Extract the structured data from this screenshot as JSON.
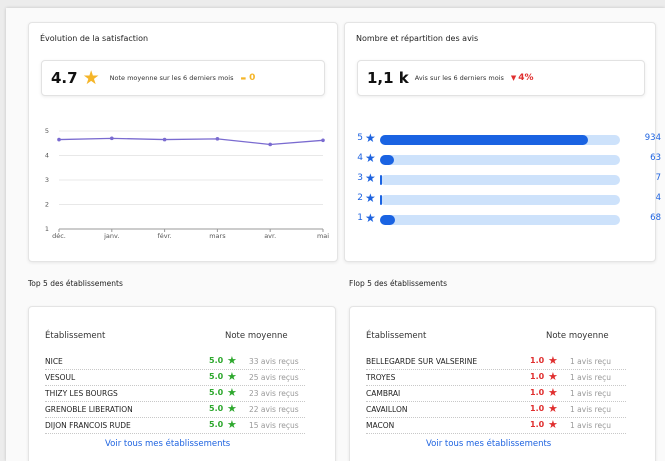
{
  "colors": {
    "accent": "#1e63e0",
    "bar_fill": "#1a63e2",
    "bar_track": "#cde2fb",
    "star_yellow": "#f5b528",
    "green": "#2ea82e",
    "red": "#e02f2f",
    "line": "#7a6bd0"
  },
  "satisfaction": {
    "title": "Évolution de la satisfaction",
    "value": "4.7",
    "star_icon": "star-icon",
    "desc": "Note moyenne sur les 6 derniers mois",
    "trend_symbol": "▬",
    "trend_value": "0"
  },
  "chart_data": {
    "type": "line",
    "x": [
      "déc.",
      "janv.",
      "févr.",
      "mars",
      "avr.",
      "mai"
    ],
    "series": [
      {
        "values": [
          4.65,
          4.7,
          4.65,
          4.68,
          4.45,
          4.62
        ]
      }
    ],
    "yticks": [
      "1",
      "2",
      "3",
      "4",
      "5"
    ],
    "ylim": [
      1,
      5
    ],
    "grid": true,
    "title": "",
    "xlabel": "",
    "ylabel": ""
  },
  "avis": {
    "title": "Nombre et répartition des avis",
    "value": "1,1 k",
    "desc": "Avis sur les 6 derniers mois",
    "trend_symbol": "▼",
    "trend_value": "4%",
    "distribution": [
      {
        "stars": "5",
        "count": "934",
        "fraction": 0.865
      },
      {
        "stars": "4",
        "count": "63",
        "fraction": 0.058
      },
      {
        "stars": "3",
        "count": "7",
        "fraction": 0.006
      },
      {
        "stars": "2",
        "count": "4",
        "fraction": 0.004
      },
      {
        "stars": "1",
        "count": "68",
        "fraction": 0.063
      }
    ]
  },
  "top5": {
    "section_title": "Top 5 des établissements",
    "col_name": "Établissement",
    "col_note": "Note moyenne",
    "rows": [
      {
        "name": "NICE",
        "note": "5.0",
        "avis": "33 avis reçus"
      },
      {
        "name": "VESOUL",
        "note": "5.0",
        "avis": "25 avis reçus"
      },
      {
        "name": "THIZY LES BOURGS",
        "note": "5.0",
        "avis": "23 avis reçus"
      },
      {
        "name": "GRENOBLE LIBERATION",
        "note": "5.0",
        "avis": "22 avis reçus"
      },
      {
        "name": "DIJON FRANCOIS RUDE",
        "note": "5.0",
        "avis": "15 avis reçus"
      }
    ],
    "link": "Voir tous mes établissements"
  },
  "flop5": {
    "section_title": "Flop 5 des établissements",
    "col_name": "Établissement",
    "col_note": "Note moyenne",
    "rows": [
      {
        "name": "BELLEGARDE SUR VALSERINE",
        "note": "1.0",
        "avis": "1 avis reçu"
      },
      {
        "name": "TROYES",
        "note": "1.0",
        "avis": "1 avis reçu"
      },
      {
        "name": "CAMBRAI",
        "note": "1.0",
        "avis": "1 avis reçu"
      },
      {
        "name": "CAVAILLON",
        "note": "1.0",
        "avis": "1 avis reçu"
      },
      {
        "name": "MACON",
        "note": "1.0",
        "avis": "1 avis reçu"
      }
    ],
    "link": "Voir tous mes établissements"
  }
}
